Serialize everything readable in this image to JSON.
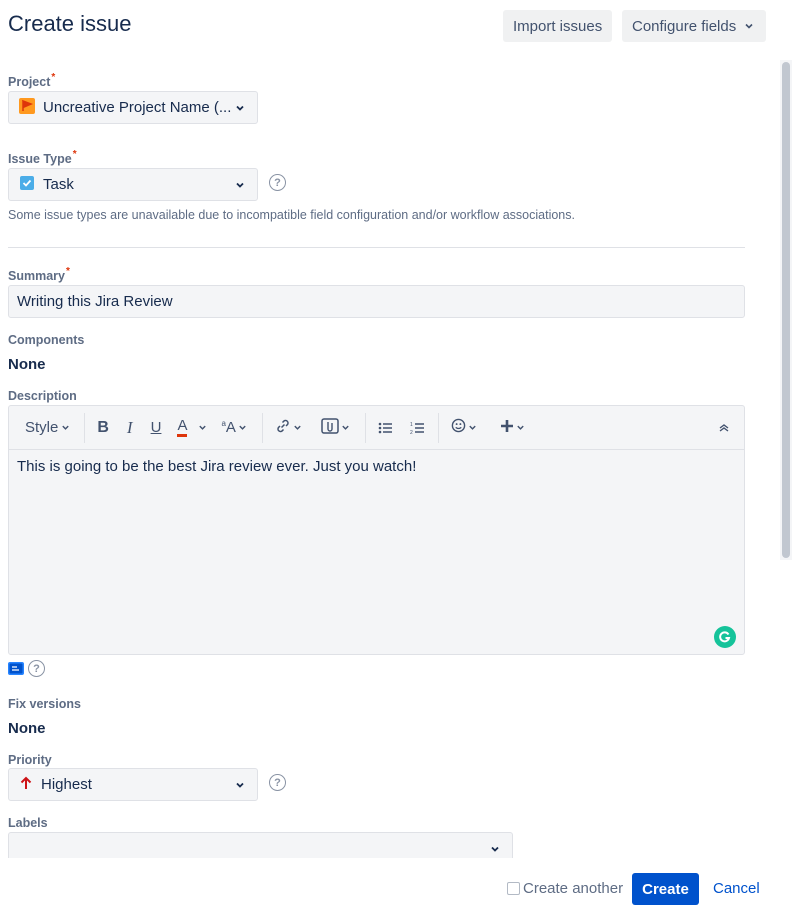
{
  "header": {
    "title": "Create issue",
    "import_label": "Import issues",
    "configure_label": "Configure fields"
  },
  "project": {
    "label": "Project",
    "value": "Uncreative Project Name (..."
  },
  "issue_type": {
    "label": "Issue Type",
    "value": "Task",
    "note": "Some issue types are unavailable due to incompatible field configuration and/or workflow associations."
  },
  "summary": {
    "label": "Summary",
    "value": "Writing this Jira Review"
  },
  "components": {
    "label": "Components",
    "value": "None"
  },
  "description": {
    "label": "Description",
    "style_label": "Style",
    "text": "This is going to be the best Jira review ever. Just you watch!"
  },
  "fix_versions": {
    "label": "Fix versions",
    "value": "None"
  },
  "priority": {
    "label": "Priority",
    "value": "Highest"
  },
  "labels": {
    "label": "Labels",
    "value": ""
  },
  "footer": {
    "create_another_label": "Create another",
    "create_label": "Create",
    "cancel_label": "Cancel"
  },
  "colors": {
    "primary": "#0052cc",
    "required": "#de350b",
    "priority_highest": "#cd1317",
    "task_icon": "#4bade8",
    "project_icon": "#ff991f"
  }
}
